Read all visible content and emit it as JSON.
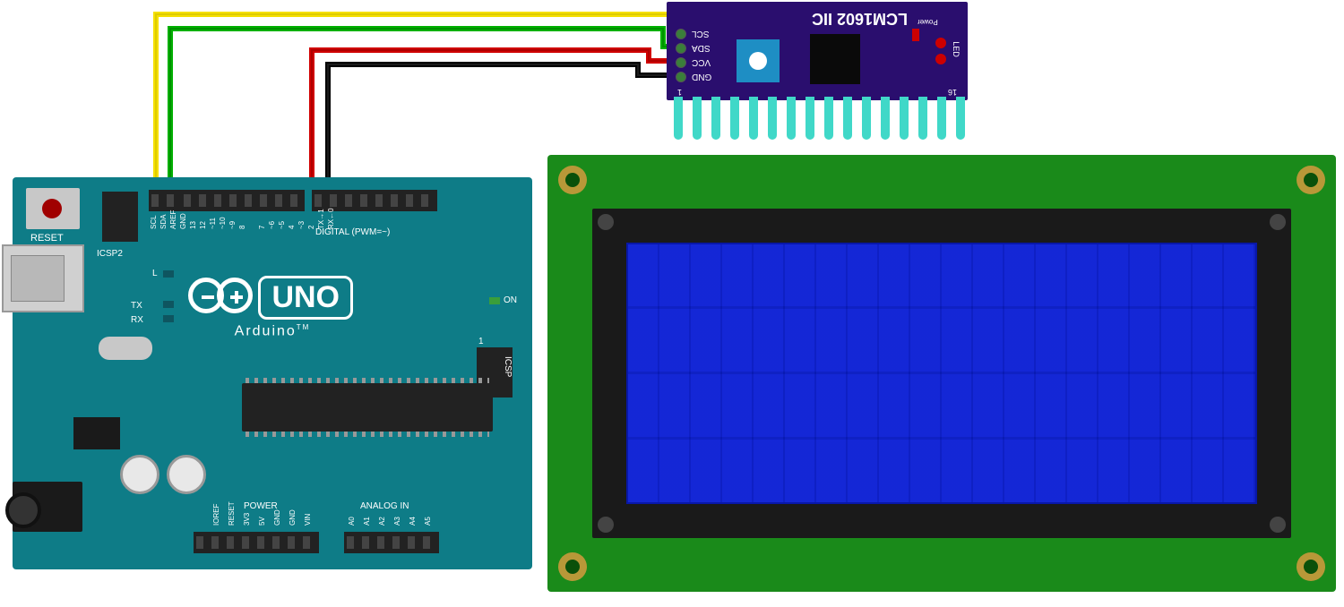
{
  "arduino": {
    "brand": "Arduino",
    "model": "UNO",
    "reset_label": "RESET",
    "icsp2_label": "ICSP2",
    "icsp_label": "ICSP",
    "icsp_pin1": "1",
    "digital_label": "DIGITAL (PWM=~)",
    "power_label": "POWER",
    "analog_label": "ANALOG IN",
    "tx_label": "TX",
    "rx_label": "RX",
    "l_label": "L",
    "on_label": "ON",
    "tm": "TM",
    "pins_top": [
      "SCL",
      "SDA",
      "AREF",
      "GND",
      "13",
      "12",
      "~11",
      "~10",
      "~9",
      "8",
      "",
      "7",
      "~6",
      "~5",
      "4",
      "~3",
      "2",
      "TX→1",
      "RX←0"
    ],
    "pins_power": [
      "IOREF",
      "RESET",
      "3V3",
      "5V",
      "GND",
      "GND",
      "VIN"
    ],
    "pins_analog": [
      "A0",
      "A1",
      "A2",
      "A3",
      "A4",
      "A5"
    ]
  },
  "i2c": {
    "name": "LCM1602 IIC",
    "scl": "SCL",
    "sda": "SDA",
    "vcc": "VCC",
    "gnd": "GND",
    "power_label": "Power",
    "led_label": "LED",
    "pin1": "1",
    "pin16": "16"
  },
  "wires": {
    "scl": {
      "color": "#f5e000",
      "name": "SCL wire (yellow)"
    },
    "sda": {
      "color": "#00b000",
      "name": "SDA wire (green)"
    },
    "vcc": {
      "color": "#d00000",
      "name": "VCC / 5V wire (red)"
    },
    "gnd": {
      "color": "#000000",
      "name": "GND wire (black)"
    }
  },
  "lcd": {
    "type": "20x4 Character LCD",
    "backlight": "blue"
  }
}
